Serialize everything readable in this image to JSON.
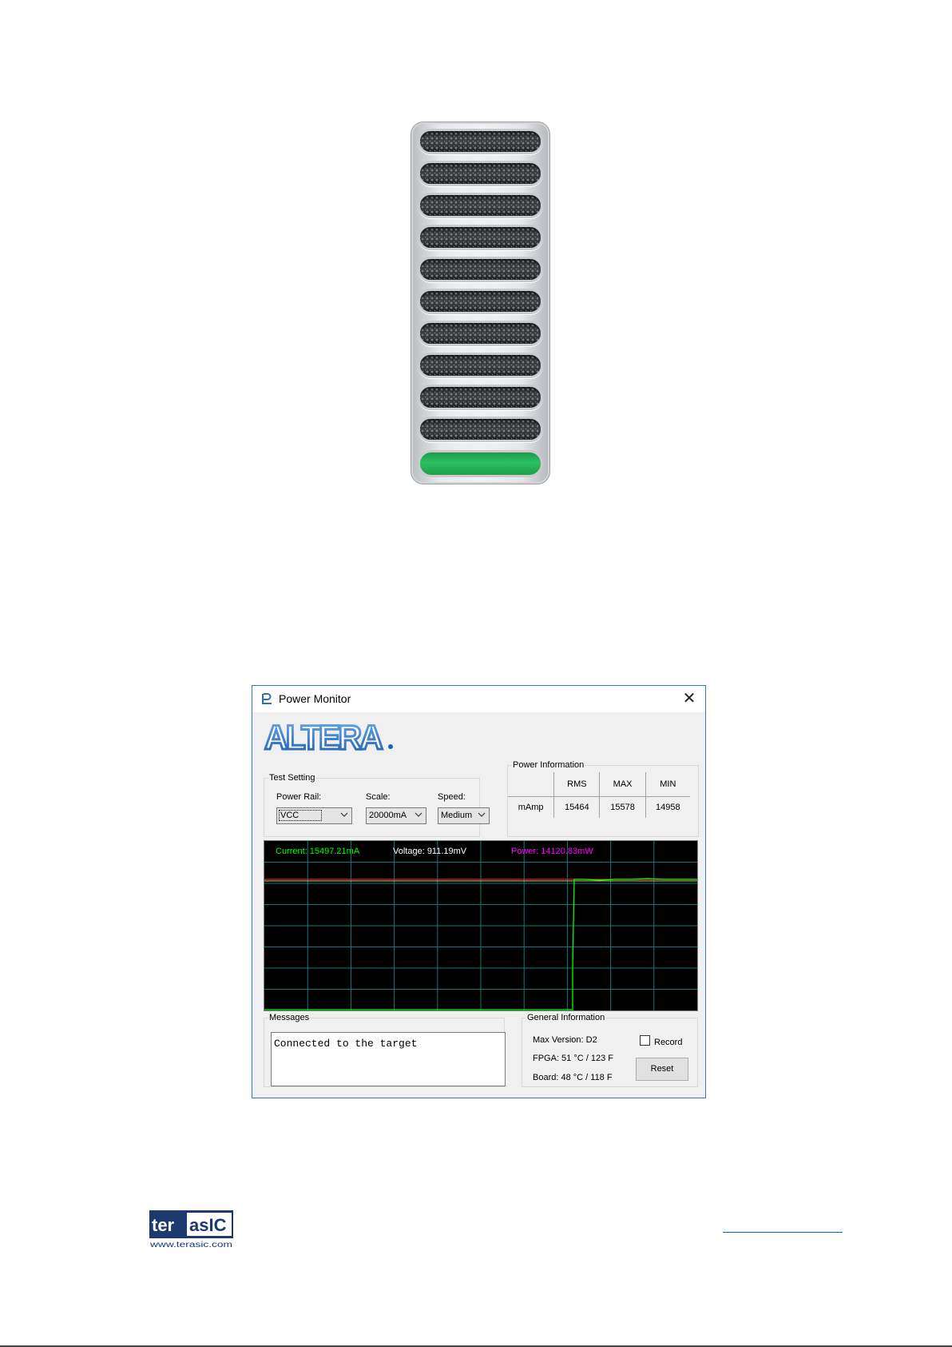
{
  "window": {
    "title": "Power Monitor",
    "close_glyph": "✕",
    "logo_text": "ALTERA"
  },
  "test_setting": {
    "legend": "Test Setting",
    "power_rail_label": "Power Rail:",
    "power_rail_value": "VCC",
    "scale_label": "Scale:",
    "scale_value": "20000mA",
    "speed_label": "Speed:",
    "speed_value": "Medium"
  },
  "power_information": {
    "legend": "Power Information",
    "columns": [
      "RMS",
      "MAX",
      "MIN"
    ],
    "row_label": "mAmp",
    "values": [
      "15464",
      "15578",
      "14958"
    ]
  },
  "scope": {
    "current_text": "Current: 15497.21mA",
    "voltage_text": "Voltage: 911.19mV",
    "power_text": "Power: 14120.83mW",
    "colors": {
      "current": "#00ff00",
      "voltage": "#ffffff",
      "power": "#ff00ff",
      "grid": "#117a7a",
      "limit_line": "#e02020",
      "max_line": "#c8c864"
    }
  },
  "messages": {
    "legend": "Messages",
    "text": "Connected to the target"
  },
  "general_information": {
    "legend": "General Information",
    "max_version": "Max Version:  D2",
    "fpga": "FPGA:  51 °C / 123 F",
    "board": "Board:  48 °C / 118 F",
    "record_label": "Record",
    "record_checked": false,
    "reset_label": "Reset"
  },
  "footer": {
    "brand": "terasIC",
    "url": "www.terasic.com"
  }
}
